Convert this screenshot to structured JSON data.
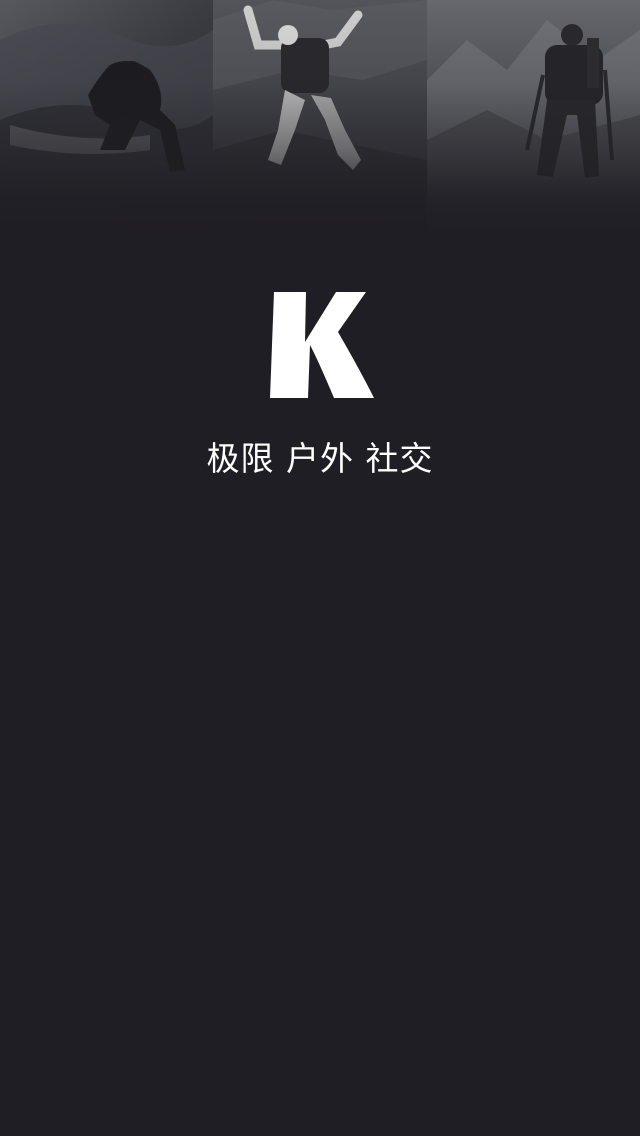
{
  "app": {
    "logo_letter": "K",
    "tagline_parts": [
      "极限",
      "户外",
      "社交"
    ]
  },
  "hero": {
    "photos": [
      {
        "subject": "surfer"
      },
      {
        "subject": "skydiver"
      },
      {
        "subject": "mountaineer"
      }
    ]
  },
  "colors": {
    "background": "#1f1e24",
    "logo": "#ffffff",
    "tagline": "#ffffff"
  }
}
